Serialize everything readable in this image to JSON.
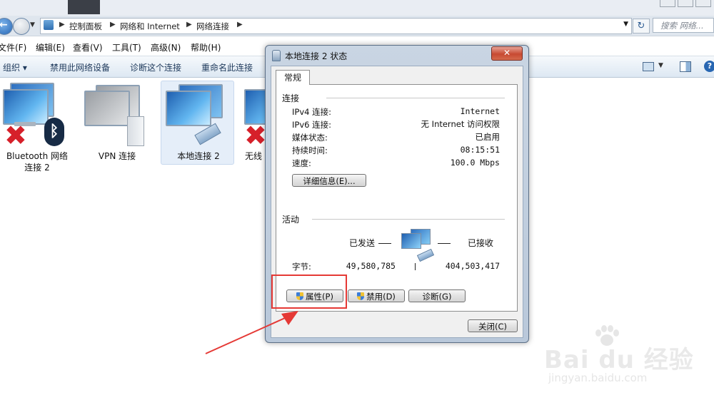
{
  "window": {
    "breadcrumb": [
      "控制面板",
      "网络和 Internet",
      "网络连接"
    ],
    "search_placeholder": "搜索 网络..."
  },
  "menu": [
    "文件(F)",
    "编辑(E)",
    "查看(V)",
    "工具(T)",
    "高级(N)",
    "帮助(H)"
  ],
  "commands": {
    "organize": "组织 ▾",
    "disable": "禁用此网络设备",
    "diagnose": "诊断这个连接",
    "rename": "重命名此连接"
  },
  "connections": [
    {
      "label_line1": "Bluetooth 网络",
      "label_line2": "连接 2",
      "icon": "bluetooth-network-icon",
      "status": "disconnected"
    },
    {
      "label_line1": "VPN 连接",
      "label_line2": "",
      "icon": "vpn-icon",
      "status": "inactive"
    },
    {
      "label_line1": "本地连接 2",
      "label_line2": "",
      "icon": "ethernet-icon",
      "status": "connected"
    },
    {
      "label_line1": "无线",
      "label_line2": "",
      "icon": "wireless-icon",
      "status": "disconnected"
    }
  ],
  "dialog": {
    "title": "本地连接 2 状态",
    "close_glyph": "✕",
    "tab": "常规",
    "connection_group": "连接",
    "rows": [
      {
        "label": "IPv4 连接:",
        "value": "Internet"
      },
      {
        "label": "IPv6 连接:",
        "value": "无 Internet 访问权限"
      },
      {
        "label": "媒体状态:",
        "value": "已启用"
      },
      {
        "label": "持续时间:",
        "value": "08:15:51"
      },
      {
        "label": "速度:",
        "value": "100.0 Mbps"
      }
    ],
    "details_button": "详细信息(E)...",
    "activity_group": "活动",
    "sent_label": "已发送",
    "received_label": "已接收",
    "bytes_label": "字节:",
    "bytes_sent": "49,580,785",
    "bytes_received": "404,503,417",
    "properties_button": "属性(P)",
    "disable_button": "禁用(D)",
    "diagnose_button": "诊断(G)",
    "close_button": "关闭(C)"
  },
  "watermark": {
    "logo": "Bai du 经验",
    "url": "jingyan.baidu.com"
  },
  "colors": {
    "annotation": "#e53935",
    "selection": "#e5eef9",
    "dialog_frame": "#c9d5e3"
  }
}
